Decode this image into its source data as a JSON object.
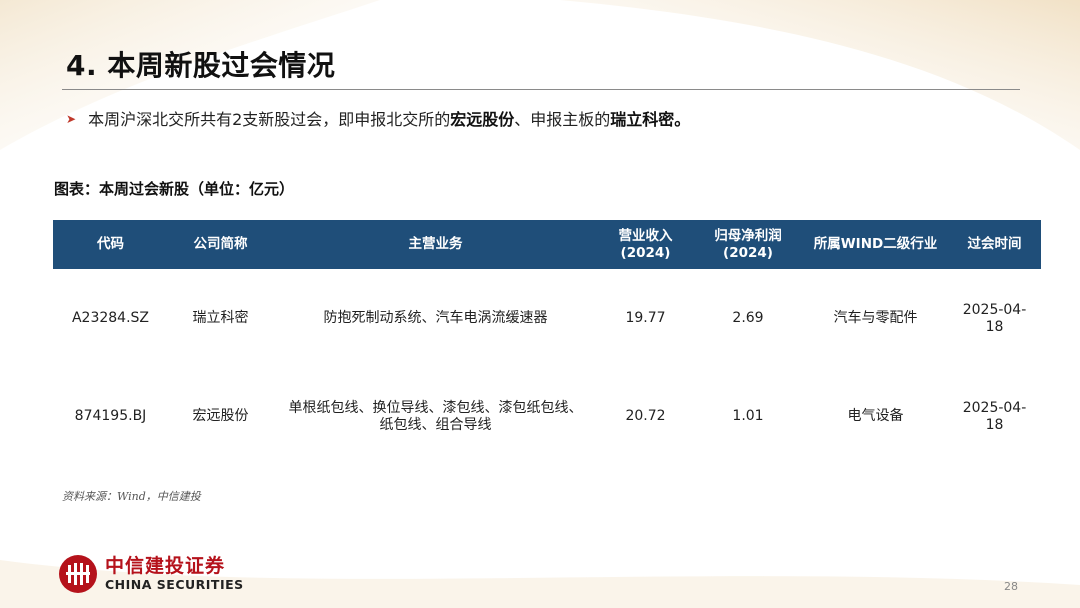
{
  "title": "4. 本周新股过会情况",
  "bullet": {
    "text_1": "本周沪深北交所共有2支新股过会，即申报北交所的",
    "bold_1": "宏远股份",
    "text_2": "、申报主板的",
    "bold_2": "瑞立科密",
    "text_3": "。"
  },
  "caption": "图表：本周过会新股（单位：亿元）",
  "table": {
    "headers": [
      {
        "line1": "代码",
        "line2": ""
      },
      {
        "line1": "公司简称",
        "line2": ""
      },
      {
        "line1": "主营业务",
        "line2": ""
      },
      {
        "line1": "营业收入",
        "line2": "(2024)"
      },
      {
        "line1": "归母净利润",
        "line2": "(2024)"
      },
      {
        "line1": "所属WIND二级行业",
        "line2": ""
      },
      {
        "line1": "过会时间",
        "line2": ""
      }
    ],
    "rows": [
      {
        "code": "A23284.SZ",
        "name": "瑞立科密",
        "business": "防抱死制动系统、汽车电涡流缓速器",
        "revenue": "19.77",
        "profit": "2.69",
        "industry": "汽车与零配件",
        "date": "2025-04-18"
      },
      {
        "code": "874195.BJ",
        "name": "宏远股份",
        "business": "单根纸包线、换位导线、漆包线、漆包纸包线、纸包线、组合导线",
        "revenue": "20.72",
        "profit": "1.01",
        "industry": "电气设备",
        "date": "2025-04-18"
      }
    ]
  },
  "source": "资料来源：Wind，中信建投",
  "logo": {
    "name_cn": "中信建投证券",
    "name_en": "CHINA SECURITIES",
    "icon": "citic-logo-icon",
    "color": "#b5121b"
  },
  "page_number": "28",
  "colors": {
    "header_bg": "#1f4e79",
    "arrow": "#c0392b"
  }
}
